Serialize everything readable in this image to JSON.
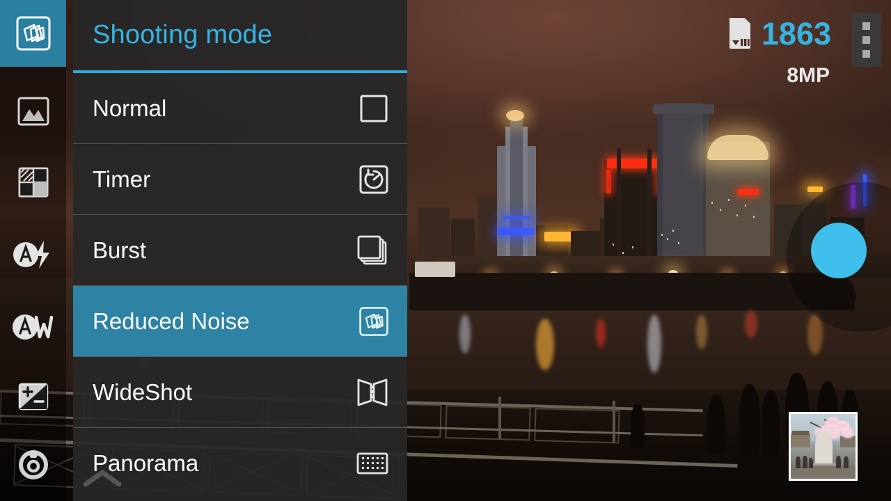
{
  "app": {
    "name": "Camera"
  },
  "sidebar": {
    "items": [
      {
        "name": "shooting-mode",
        "label": "Shooting mode",
        "icon": "cards-stack-icon",
        "active": true
      },
      {
        "name": "scene-mode",
        "label": "Scene mode",
        "icon": "landscape-icon",
        "active": false
      },
      {
        "name": "effects",
        "label": "Effects",
        "icon": "quadrant-filter-icon",
        "active": false
      },
      {
        "name": "flash",
        "label": "Auto flash",
        "icon": "auto-flash-icon",
        "active": false
      },
      {
        "name": "white-balance",
        "label": "Auto white balance",
        "icon": "auto-white-balance-icon",
        "active": false
      },
      {
        "name": "exposure",
        "label": "Exposure value",
        "icon": "exposure-compensation-icon",
        "active": false
      },
      {
        "name": "settings",
        "label": "Settings",
        "icon": "settings-icon",
        "active": false
      }
    ]
  },
  "panel": {
    "title": "Shooting mode",
    "options": [
      {
        "label": "Normal",
        "icon": "single-frame-icon",
        "selected": false
      },
      {
        "label": "Timer",
        "icon": "timer-icon",
        "selected": false
      },
      {
        "label": "Burst",
        "icon": "burst-stack-icon",
        "selected": false
      },
      {
        "label": "Reduced Noise",
        "icon": "cards-stack-icon",
        "selected": true
      },
      {
        "label": "WideShot",
        "icon": "wideshot-icon",
        "selected": false
      },
      {
        "label": "Panorama",
        "icon": "panorama-grid-icon",
        "selected": false
      }
    ],
    "scroll_indicator": "chevron-up-icon"
  },
  "status": {
    "storage_icon": "sd-card-icon",
    "shots_remaining": "1863",
    "resolution": "8MP",
    "overflow_menu": "overflow-menu-icon"
  },
  "controls": {
    "shutter": "shutter-button",
    "thumbnail": "last-photo-thumbnail"
  },
  "colors": {
    "accent": "#35b4e4",
    "selection": "#2e83a5",
    "rail_active": "#2b7fa0",
    "shutter": "#3fc0ec",
    "panel_bg": "#282828",
    "text": "#ffffff"
  }
}
